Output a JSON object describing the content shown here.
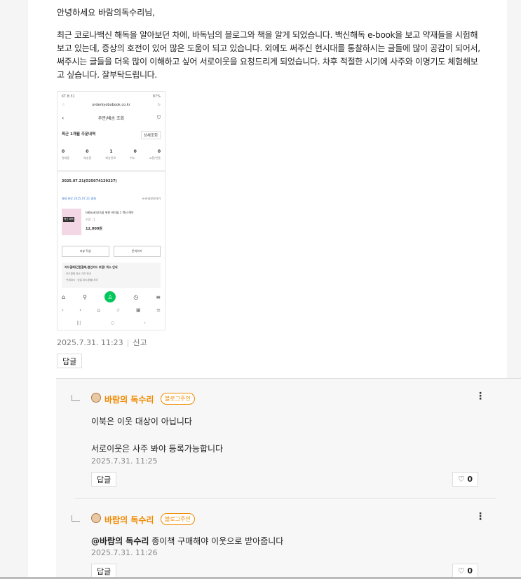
{
  "comment": {
    "greeting": "안녕하세요 바람의독수리님,",
    "body_lines": [
      "최근 코로나백신 해독을 알아보던 차에, 바독님의 블로그와 책을 알게 되었습니다. 백신해독 e-book을 보고 약재들을 시험해",
      "보고 있는데, 증상의 호전이 있어 많은 도움이 되고 있습니다. 외에도 써주신 현시대를 통찰하시는 글들에 많이 공감이 되어서,",
      "써주시는 글들을 더욱 많이 이해하고 싶어 서로이웃을 요청드리게 되었습니다. 차후 적절한 시기에 사주와 이명기도 체험해보",
      "고 싶습니다. 잘부탁드립니다."
    ],
    "date": "2025.7.31. 11:23",
    "report_label": "신고",
    "reply_label": "답글"
  },
  "screenshot": {
    "status_left": "KT 8:31",
    "status_right": "87%",
    "url": "orderkyobobook.co.kr",
    "page_title": "주문/배송 조회",
    "section_title": "최근 1개월 주문내역",
    "detail_btn": "상세조회",
    "counts": [
      "0",
      "0",
      "1",
      "0",
      "0"
    ],
    "count_labels": [
      "결제중",
      "배송중",
      "배송완료",
      "취소",
      "교환/반품"
    ],
    "order_no": "2025.07.21(O25074129227)",
    "order_meta_left": "결제 완료  2025.07.21 결제",
    "order_meta_right": "e-러닝보러가기",
    "product_name": "[eBook]성숙을 위한 바이블 1 백신 해독",
    "product_qty": "수량 : 1",
    "product_price": "12,000원",
    "cover_label": "백신 해독",
    "btn_left": "리뷰 작성",
    "btn_right": "문의하기",
    "notice_title": "카드결제(간편결제,법인카드 포함) 취소 안내",
    "notice_line1": "· 카드결제 취소 기간 안내",
    "notice_line2": "· 전체취소 : 당일 취소/환불 처리"
  },
  "replies": [
    {
      "nickname": "바람의 독수리",
      "badge": "블로그주인",
      "lines": [
        "이북은 이웃 대상이 아닙니다",
        "서로이웃은 사주 봐야 등록가능합니다"
      ],
      "date": "2025.7.31. 11:25",
      "reply_label": "답글",
      "likes": "0"
    },
    {
      "nickname": "바람의 독수리",
      "badge": "블로그주인",
      "mention": "@바람의 독수리",
      "text": "종이책 구매해야 이웃으로 받아줍니다",
      "date": "2025.7.31. 11:26",
      "reply_label": "답글",
      "likes": "0"
    }
  ],
  "colors": {
    "accent": "#f08a00",
    "nav_green": "#03c75a"
  }
}
